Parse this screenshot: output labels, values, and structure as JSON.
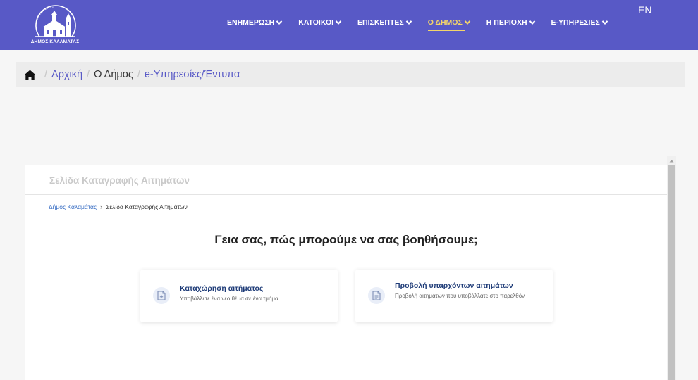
{
  "header": {
    "logo_caption": "ΔΗΜΟΣ ΚΑΛΑΜΑΤΑΣ",
    "logo_arc_text": "23 ΜΑΡΤΙΟΥ 1821",
    "nav": [
      {
        "label": "ΕΝΗΜΕΡΩΣΗ",
        "active": false
      },
      {
        "label": "ΚΑΤΟΙΚΟΙ",
        "active": false
      },
      {
        "label": "ΕΠΙΣΚΕΠΤΕΣ",
        "active": false
      },
      {
        "label": "Ο ΔΗΜΟΣ",
        "active": true
      },
      {
        "label": "Η ΠΕΡΙΟΧΗ",
        "active": false
      },
      {
        "label": "Ε-ΥΠΗΡΕΣΙΕΣ",
        "active": false
      }
    ],
    "lang": "EN",
    "colors": {
      "bar": "#5859c6",
      "active": "#f3d56a"
    }
  },
  "breadcrumb": {
    "home_icon": "home-icon",
    "items": [
      {
        "label": "Αρχική"
      },
      {
        "label": "Ο Δήμος"
      },
      {
        "label": "e-Υπηρεσίες/Έντυπα"
      }
    ]
  },
  "panel": {
    "title": "Σελίδα Καταγραφής Αιτημάτων",
    "sub_breadcrumb": {
      "link": "Δήμος Καλαμάτας",
      "current": "Σελίδα Καταγραφής Αιτημάτων"
    },
    "greeting": "Γεια σας, πώς μπορούμε να σας βοηθήσουμε;",
    "cards": [
      {
        "icon": "document-plus-icon",
        "title": "Καταχώρηση αιτήματος",
        "desc": "Υποβάλλετε ένα νέο θέμα σε ένα τμήμα"
      },
      {
        "icon": "document-lines-icon",
        "title": "Προβολή υπαρχόντων αιτημάτων",
        "desc": "Προβολή αιτημάτων που υποβάλλατε στο παρελθόν"
      }
    ]
  }
}
